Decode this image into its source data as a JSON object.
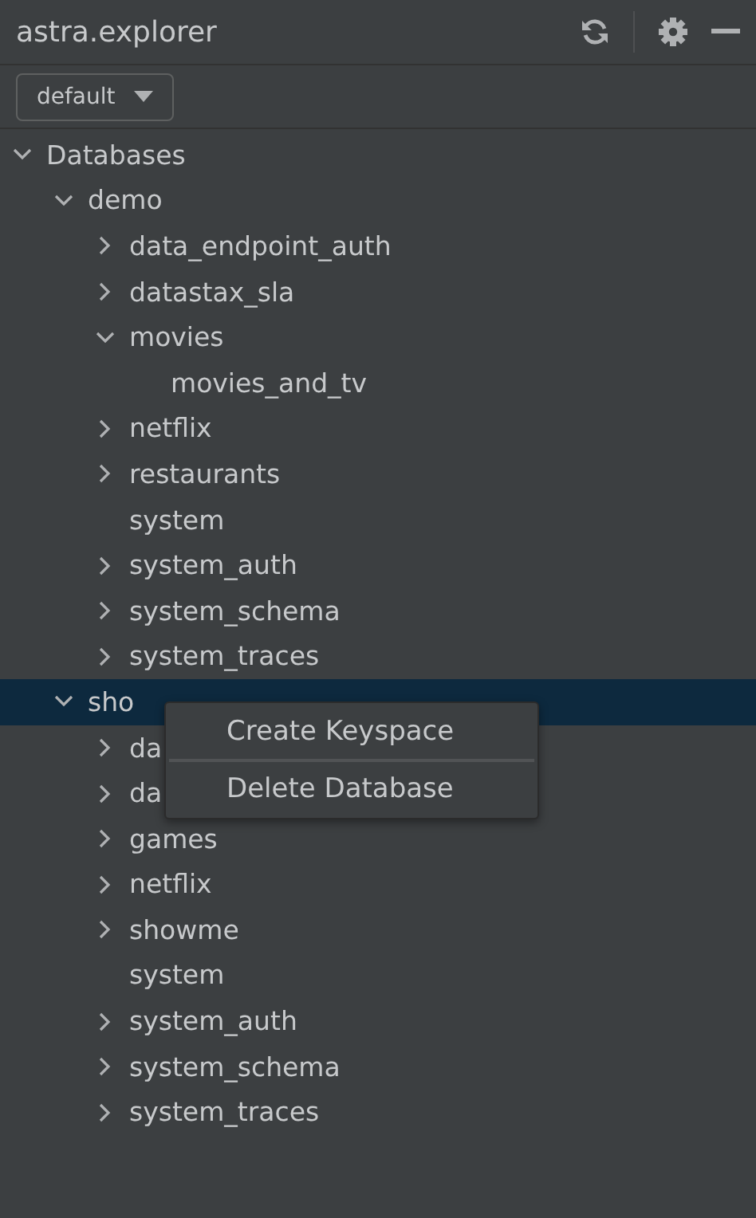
{
  "window": {
    "title": "astra.explorer"
  },
  "profile_dropdown": {
    "value": "default"
  },
  "tree": [
    {
      "label": "Databases",
      "kind": "folder",
      "expanded": true,
      "selected": false,
      "children": [
        {
          "label": "demo",
          "kind": "folder",
          "expanded": true,
          "selected": false,
          "children": [
            {
              "label": "data_endpoint_auth",
              "kind": "folder",
              "expanded": false,
              "selected": false
            },
            {
              "label": "datastax_sla",
              "kind": "folder",
              "expanded": false,
              "selected": false
            },
            {
              "label": "movies",
              "kind": "folder",
              "expanded": true,
              "selected": false,
              "children": [
                {
                  "label": "movies_and_tv",
                  "kind": "leaf",
                  "selected": false
                }
              ]
            },
            {
              "label": "netflix",
              "kind": "folder",
              "expanded": false,
              "selected": false
            },
            {
              "label": "restaurants",
              "kind": "folder",
              "expanded": false,
              "selected": false
            },
            {
              "label": "system",
              "kind": "leaf",
              "selected": false
            },
            {
              "label": "system_auth",
              "kind": "folder",
              "expanded": false,
              "selected": false
            },
            {
              "label": "system_schema",
              "kind": "folder",
              "expanded": false,
              "selected": false
            },
            {
              "label": "system_traces",
              "kind": "folder",
              "expanded": false,
              "selected": false
            }
          ]
        },
        {
          "label": "sho",
          "kind": "folder",
          "expanded": true,
          "selected": true,
          "children": [
            {
              "label": "da",
              "kind": "folder",
              "expanded": false,
              "selected": false
            },
            {
              "label": "da",
              "kind": "folder",
              "expanded": false,
              "selected": false
            },
            {
              "label": "games",
              "kind": "folder",
              "expanded": false,
              "selected": false
            },
            {
              "label": "netflix",
              "kind": "folder",
              "expanded": false,
              "selected": false
            },
            {
              "label": "showme",
              "kind": "folder",
              "expanded": false,
              "selected": false
            },
            {
              "label": "system",
              "kind": "leaf",
              "selected": false
            },
            {
              "label": "system_auth",
              "kind": "folder",
              "expanded": false,
              "selected": false
            },
            {
              "label": "system_schema",
              "kind": "folder",
              "expanded": false,
              "selected": false
            },
            {
              "label": "system_traces",
              "kind": "folder",
              "expanded": false,
              "selected": false
            }
          ]
        }
      ]
    }
  ],
  "context_menu": {
    "items": [
      "Create Keyspace",
      "Delete Database"
    ]
  }
}
